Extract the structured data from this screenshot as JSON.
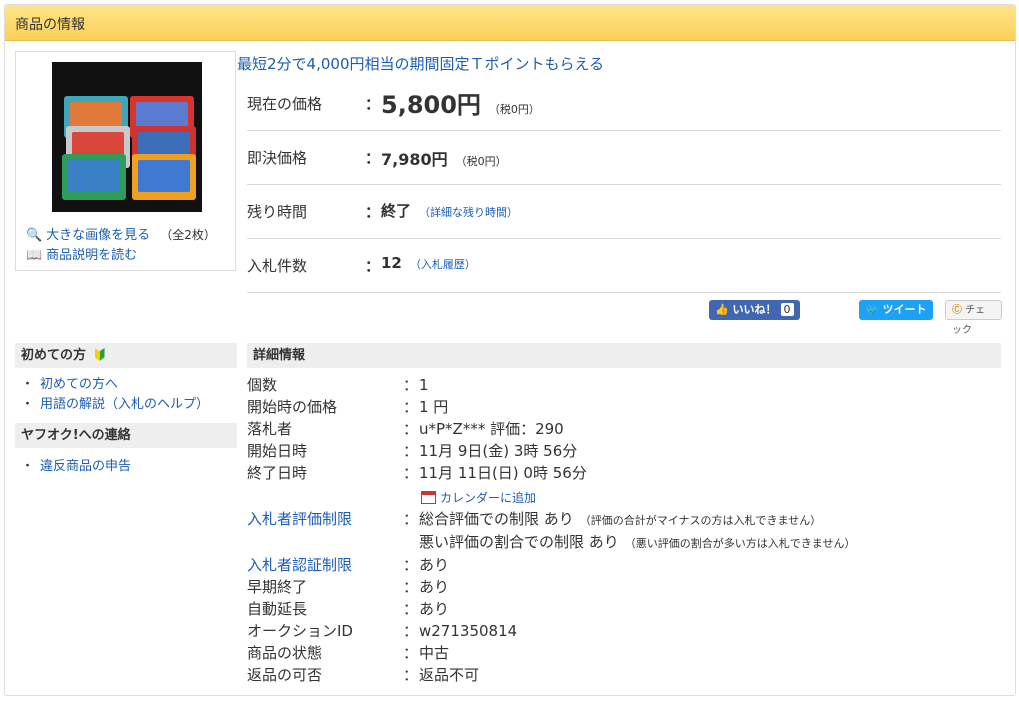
{
  "section_title": "商品の情報",
  "images": {
    "view_large": "大きな画像を見る",
    "count": "（全2枚）",
    "read_desc": "商品説明を読む"
  },
  "promo": "最短2分で4,000円相当の期間固定Ｔポイントもらえる",
  "current_price": {
    "label": "現在の価格",
    "value": "5,800円",
    "tax": "（税0円）"
  },
  "buyout_price": {
    "label": "即決価格",
    "value": "7,980円",
    "tax": "（税0円）"
  },
  "remaining": {
    "label": "残り時間",
    "value": "終了",
    "link": "（詳細な残り時間）"
  },
  "bids": {
    "label": "入札件数",
    "value": "12",
    "link": "（入札履歴）"
  },
  "social": {
    "like": "いいね！",
    "like_count": "0",
    "tweet": "ツイート",
    "check": "チェック"
  },
  "colon": "：",
  "sidebar": {
    "beginners": {
      "title": "初めての方",
      "links": [
        "初めての方へ",
        "用語の解説（入札のヘルプ）"
      ]
    },
    "contact": {
      "title": "ヤフオク!への連絡",
      "links": [
        "違反商品の申告"
      ]
    },
    "bullet": "・"
  },
  "detail": {
    "title": "詳細情報",
    "quantity": {
      "label": "個数",
      "value": "1"
    },
    "start_price": {
      "label": "開始時の価格",
      "value": "1 円"
    },
    "winner": {
      "label": "落札者",
      "value": "u*P*Z*** 評価：290"
    },
    "start_date": {
      "label": "開始日時",
      "value": "11月 9日(金) 3時 56分"
    },
    "end_date": {
      "label": "終了日時",
      "value": "11月 11日(日) 0時 56分"
    },
    "calendar": "カレンダーに追加",
    "rating_limit": {
      "label": "入札者評価制限",
      "line1": "総合評価での制限 あり",
      "note1": "（評価の合計がマイナスの方は入札できません）",
      "line2": "悪い評価の割合での制限 あり",
      "note2": "（悪い評価の割合が多い方は入札できません）"
    },
    "verify_limit": {
      "label": "入札者認証制限",
      "value": "あり"
    },
    "early_end": {
      "label": "早期終了",
      "value": "あり"
    },
    "auto_extend": {
      "label": "自動延長",
      "value": "あり"
    },
    "auction_id": {
      "label": "オークションID",
      "value": "w271350814"
    },
    "condition": {
      "label": "商品の状態",
      "value": "中古"
    },
    "returns": {
      "label": "返品の可否",
      "value": "返品不可"
    }
  }
}
